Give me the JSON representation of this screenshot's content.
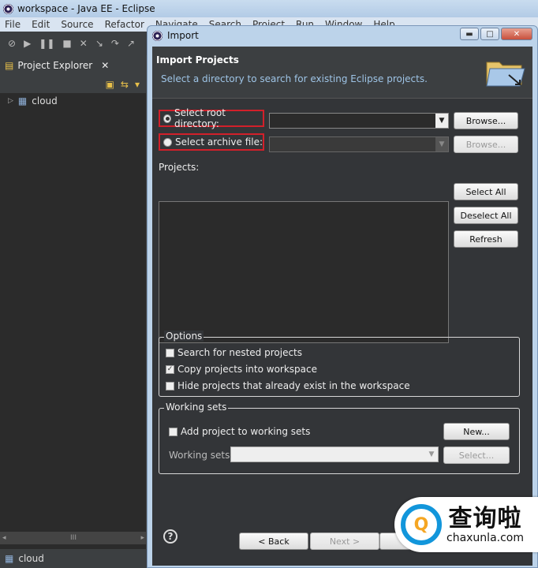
{
  "window": {
    "title": "workspace - Java EE - Eclipse",
    "menu": [
      "File",
      "Edit",
      "Source",
      "Refactor",
      "Navigate",
      "Search",
      "Project",
      "Run",
      "Window",
      "Help"
    ]
  },
  "explorer": {
    "tab_label": "Project Explorer",
    "tree": [
      {
        "label": "cloud"
      }
    ],
    "status_label": "cloud",
    "hscroll_mid": "III"
  },
  "dialog": {
    "title": "Import",
    "heading": "Import Projects",
    "description": "Select a directory to search for existing Eclipse projects.",
    "root_dir_label": "Select root directory:",
    "archive_label": "Select archive file:",
    "browse_label": "Browse...",
    "projects_label": "Projects:",
    "select_all": "Select All",
    "deselect_all": "Deselect All",
    "refresh": "Refresh",
    "options": {
      "title": "Options",
      "nested": "Search for nested projects",
      "copy": "Copy projects into workspace",
      "hide": "Hide projects that already exist in the workspace"
    },
    "working_sets": {
      "title": "Working sets",
      "add": "Add project to working sets",
      "new": "New...",
      "label": "Working sets:",
      "select": "Select..."
    },
    "back": "< Back",
    "next": "Next >"
  },
  "watermark": {
    "cn": "查询啦",
    "en": "chaxunla.com"
  }
}
